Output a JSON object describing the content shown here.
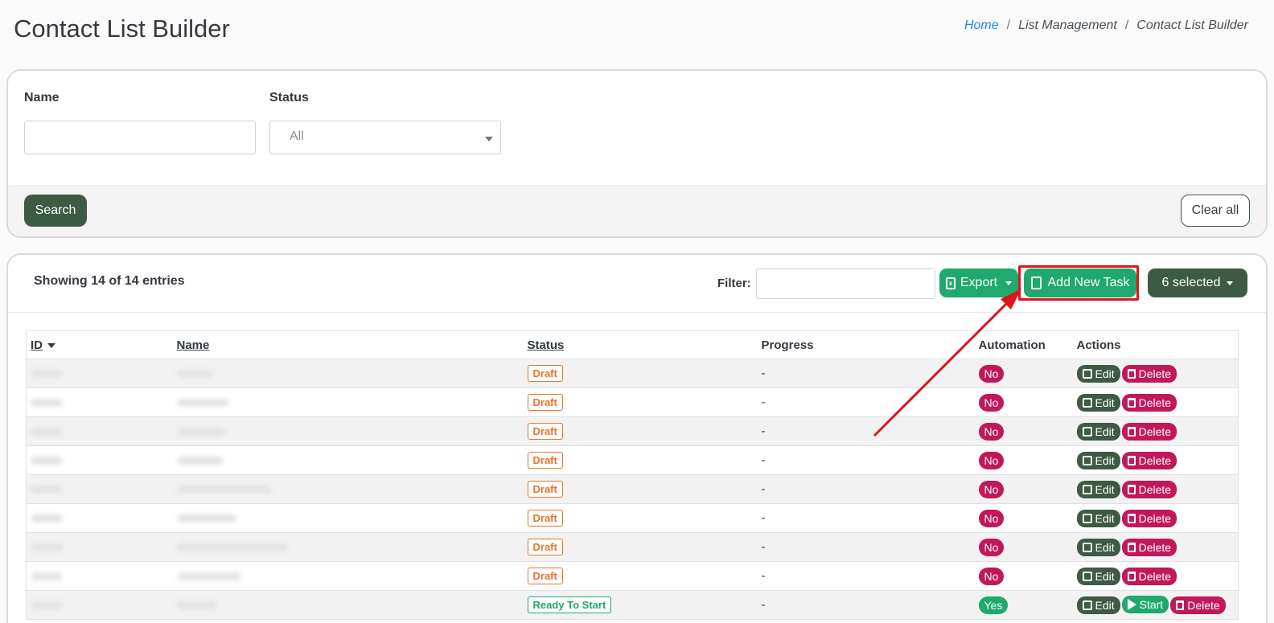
{
  "header": {
    "title": "Contact List Builder",
    "breadcrumb": {
      "home": "Home",
      "sep": "/",
      "middle": "List Management",
      "current": "Contact List Builder"
    }
  },
  "filters": {
    "name_label": "Name",
    "name_value": "",
    "status_label": "Status",
    "status_value": "All",
    "search_label": "Search",
    "clear_label": "Clear all"
  },
  "table_toolbar": {
    "showing": "Showing 14 of 14 entries",
    "filter_label": "Filter:",
    "filter_value": "",
    "export_label": "Export",
    "add_label": "Add New Task",
    "selected_label": "6 selected"
  },
  "table": {
    "columns": [
      "ID",
      "Name",
      "Status",
      "Progress",
      "Automation",
      "Actions"
    ],
    "rows": [
      {
        "status": "Draft",
        "progress": "-",
        "automation": "No",
        "actions": [
          "Edit",
          "Delete"
        ]
      },
      {
        "status": "Draft",
        "progress": "-",
        "automation": "No",
        "actions": [
          "Edit",
          "Delete"
        ]
      },
      {
        "status": "Draft",
        "progress": "-",
        "automation": "No",
        "actions": [
          "Edit",
          "Delete"
        ]
      },
      {
        "status": "Draft",
        "progress": "-",
        "automation": "No",
        "actions": [
          "Edit",
          "Delete"
        ]
      },
      {
        "status": "Draft",
        "progress": "-",
        "automation": "No",
        "actions": [
          "Edit",
          "Delete"
        ]
      },
      {
        "status": "Draft",
        "progress": "-",
        "automation": "No",
        "actions": [
          "Edit",
          "Delete"
        ]
      },
      {
        "status": "Draft",
        "progress": "-",
        "automation": "No",
        "actions": [
          "Edit",
          "Delete"
        ]
      },
      {
        "status": "Draft",
        "progress": "-",
        "automation": "No",
        "actions": [
          "Edit",
          "Delete"
        ]
      },
      {
        "status": "Ready To Start",
        "progress": "-",
        "automation": "Yes",
        "actions": [
          "Edit",
          "Start",
          "Delete"
        ]
      }
    ]
  },
  "colors": {
    "primary_dark": "#3d5a45",
    "success": "#1fa96d",
    "danger": "#c2185b",
    "draft": "#e8722c",
    "annotation": "#e0141b"
  },
  "icons": {
    "export": "file-excel-icon",
    "add": "file-icon",
    "edit": "edit-icon",
    "delete": "trash-icon",
    "start": "play-icon"
  }
}
